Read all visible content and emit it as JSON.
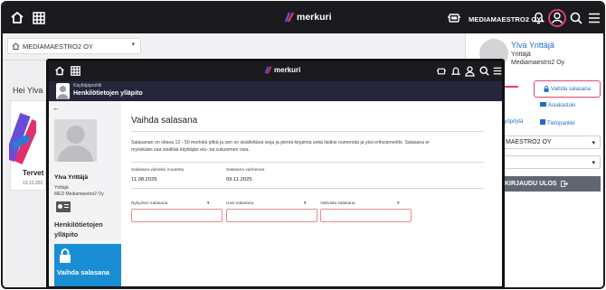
{
  "outer": {
    "brand": "merkuri",
    "company": "MEDIAMAESTRO2 OY",
    "org_select": "MEDIAMAESTRO2 OY",
    "greeting": "Hei Ylva",
    "welcome": "Tervet",
    "date": "13.12.202"
  },
  "panel": {
    "name": "Ylva Yrittäjä",
    "role": "Yrittäjä",
    "company": "Mediamaestro2 Oy",
    "change_password": "Vaihda salasana",
    "links": [
      "Asiakastuki",
      "Työpöytä",
      "Tietopankki"
    ],
    "org_select": "MAESTRO2 OY",
    "logout": "KIRJAUDU ULOS"
  },
  "inner": {
    "brand": "merkuri",
    "bar_small": "Käyttäjäprofiili",
    "bar_title": "Henkilötietojen ylläpito",
    "side": {
      "name": "Ylva Yrittäjä",
      "role": "Yrittäjä",
      "company": "MED Mediamaestro2 Oy",
      "item_personal": "Henkilötietojen ylläpito",
      "item_active": "Vaihda salasana"
    },
    "content": {
      "title": "Vaihda salasana",
      "description": "Salasanan on oltava 12 - 50 merkkiä pitkä ja sen on sisällettävä isoja ja pieniä kirjaimia sekä lisäksi numeroita ja yksi erikoismerkki. Salasana ei myöskään saa sisältää käyttäjän etu- tai sukunimen osia.",
      "last_changed_label": "Salasana viimeksi muutettu",
      "last_changed": "11.08.2025",
      "expires_label": "Salasana vanhenee",
      "expires": "09.11.2025",
      "fields": [
        {
          "label": "Nykyinen salasana",
          "value": ""
        },
        {
          "label": "Uusi salasana",
          "value": ""
        },
        {
          "label": "Vahvista salasana",
          "value": ""
        }
      ]
    }
  },
  "colors": {
    "topbar": "#1b1b1f",
    "accent_blue": "#1a8ed5",
    "highlight_pink": "#e4447a",
    "error_border": "#e98a8a"
  },
  "icons": [
    "home-icon",
    "grid-icon",
    "support-agent-icon",
    "bell-icon",
    "user-icon",
    "search-icon",
    "menu-icon",
    "lock-icon",
    "chevron-down-icon",
    "logout-icon",
    "id-card-icon",
    "back-arrow-icon"
  ]
}
